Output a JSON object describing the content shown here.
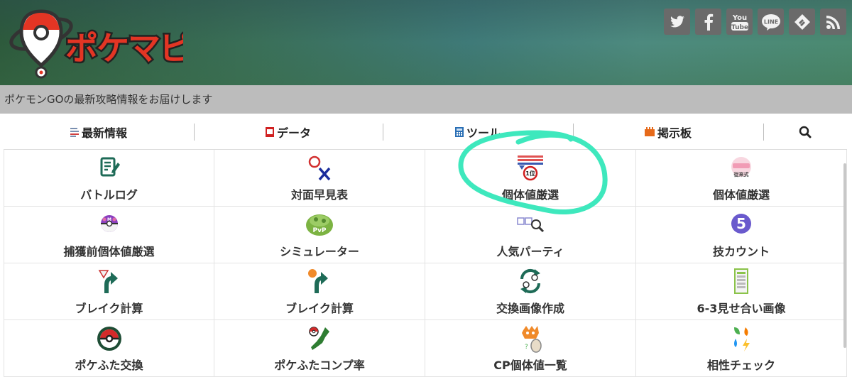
{
  "site": {
    "logo_text": "ポケマピ",
    "tagline": "ポケモンGOの最新攻略情報をお届けします"
  },
  "social": [
    {
      "name": "twitter-icon",
      "glyph": "𝕥"
    },
    {
      "name": "facebook-icon",
      "glyph": "f"
    },
    {
      "name": "youtube-icon",
      "glyph": "You\nTube"
    },
    {
      "name": "line-icon",
      "glyph": "LINE"
    },
    {
      "name": "feedly-icon",
      "glyph": "◈"
    },
    {
      "name": "rss-icon",
      "glyph": "⌇"
    }
  ],
  "nav": {
    "items": [
      {
        "label": "最新情報",
        "icon": "news-icon"
      },
      {
        "label": "データ",
        "icon": "data-icon"
      },
      {
        "label": "ツール",
        "icon": "tool-icon"
      },
      {
        "label": "掲示板",
        "icon": "board-icon"
      }
    ],
    "search_icon": "search-icon"
  },
  "grid": {
    "rows": [
      [
        {
          "label": "バトルログ",
          "icon": "battle-log-icon"
        },
        {
          "label": "対面早見表",
          "icon": "matchup-icon"
        },
        {
          "label": "個体値厳選",
          "icon": "iv-rank-icon"
        },
        {
          "label": "個体値厳選",
          "icon": "iv-legacy-icon",
          "badge": "従来式"
        }
      ],
      [
        {
          "label": "捕獲前個体値厳選",
          "icon": "master-ball-icon"
        },
        {
          "label": "シミュレーター",
          "icon": "pvp-simulator-icon",
          "badge": "PvP"
        },
        {
          "label": "人気パーティ",
          "icon": "popular-party-icon"
        },
        {
          "label": "技カウント",
          "icon": "move-count-icon",
          "badge": "5"
        }
      ],
      [
        {
          "label": "ブレイク計算",
          "icon": "break-calc-icon"
        },
        {
          "label": "ブレイク計算",
          "icon": "break-calc-2-icon"
        },
        {
          "label": "交換画像作成",
          "icon": "trade-image-icon"
        },
        {
          "label": "6-3見せ合い画像",
          "icon": "team-preview-icon"
        }
      ],
      [
        {
          "label": "ポケふた交換",
          "icon": "pokelid-trade-icon"
        },
        {
          "label": "ポケふたコンプ率",
          "icon": "pokelid-map-icon"
        },
        {
          "label": "CP個体値一覧",
          "icon": "cp-iv-list-icon"
        },
        {
          "label": "相性チェック",
          "icon": "type-check-icon"
        }
      ]
    ]
  },
  "colors": {
    "annotation": "#3ee8bd",
    "nav_news": "#7a8fb0",
    "nav_data": "#d02020",
    "nav_tool": "#2a6fb5",
    "nav_board": "#e66a1a"
  }
}
